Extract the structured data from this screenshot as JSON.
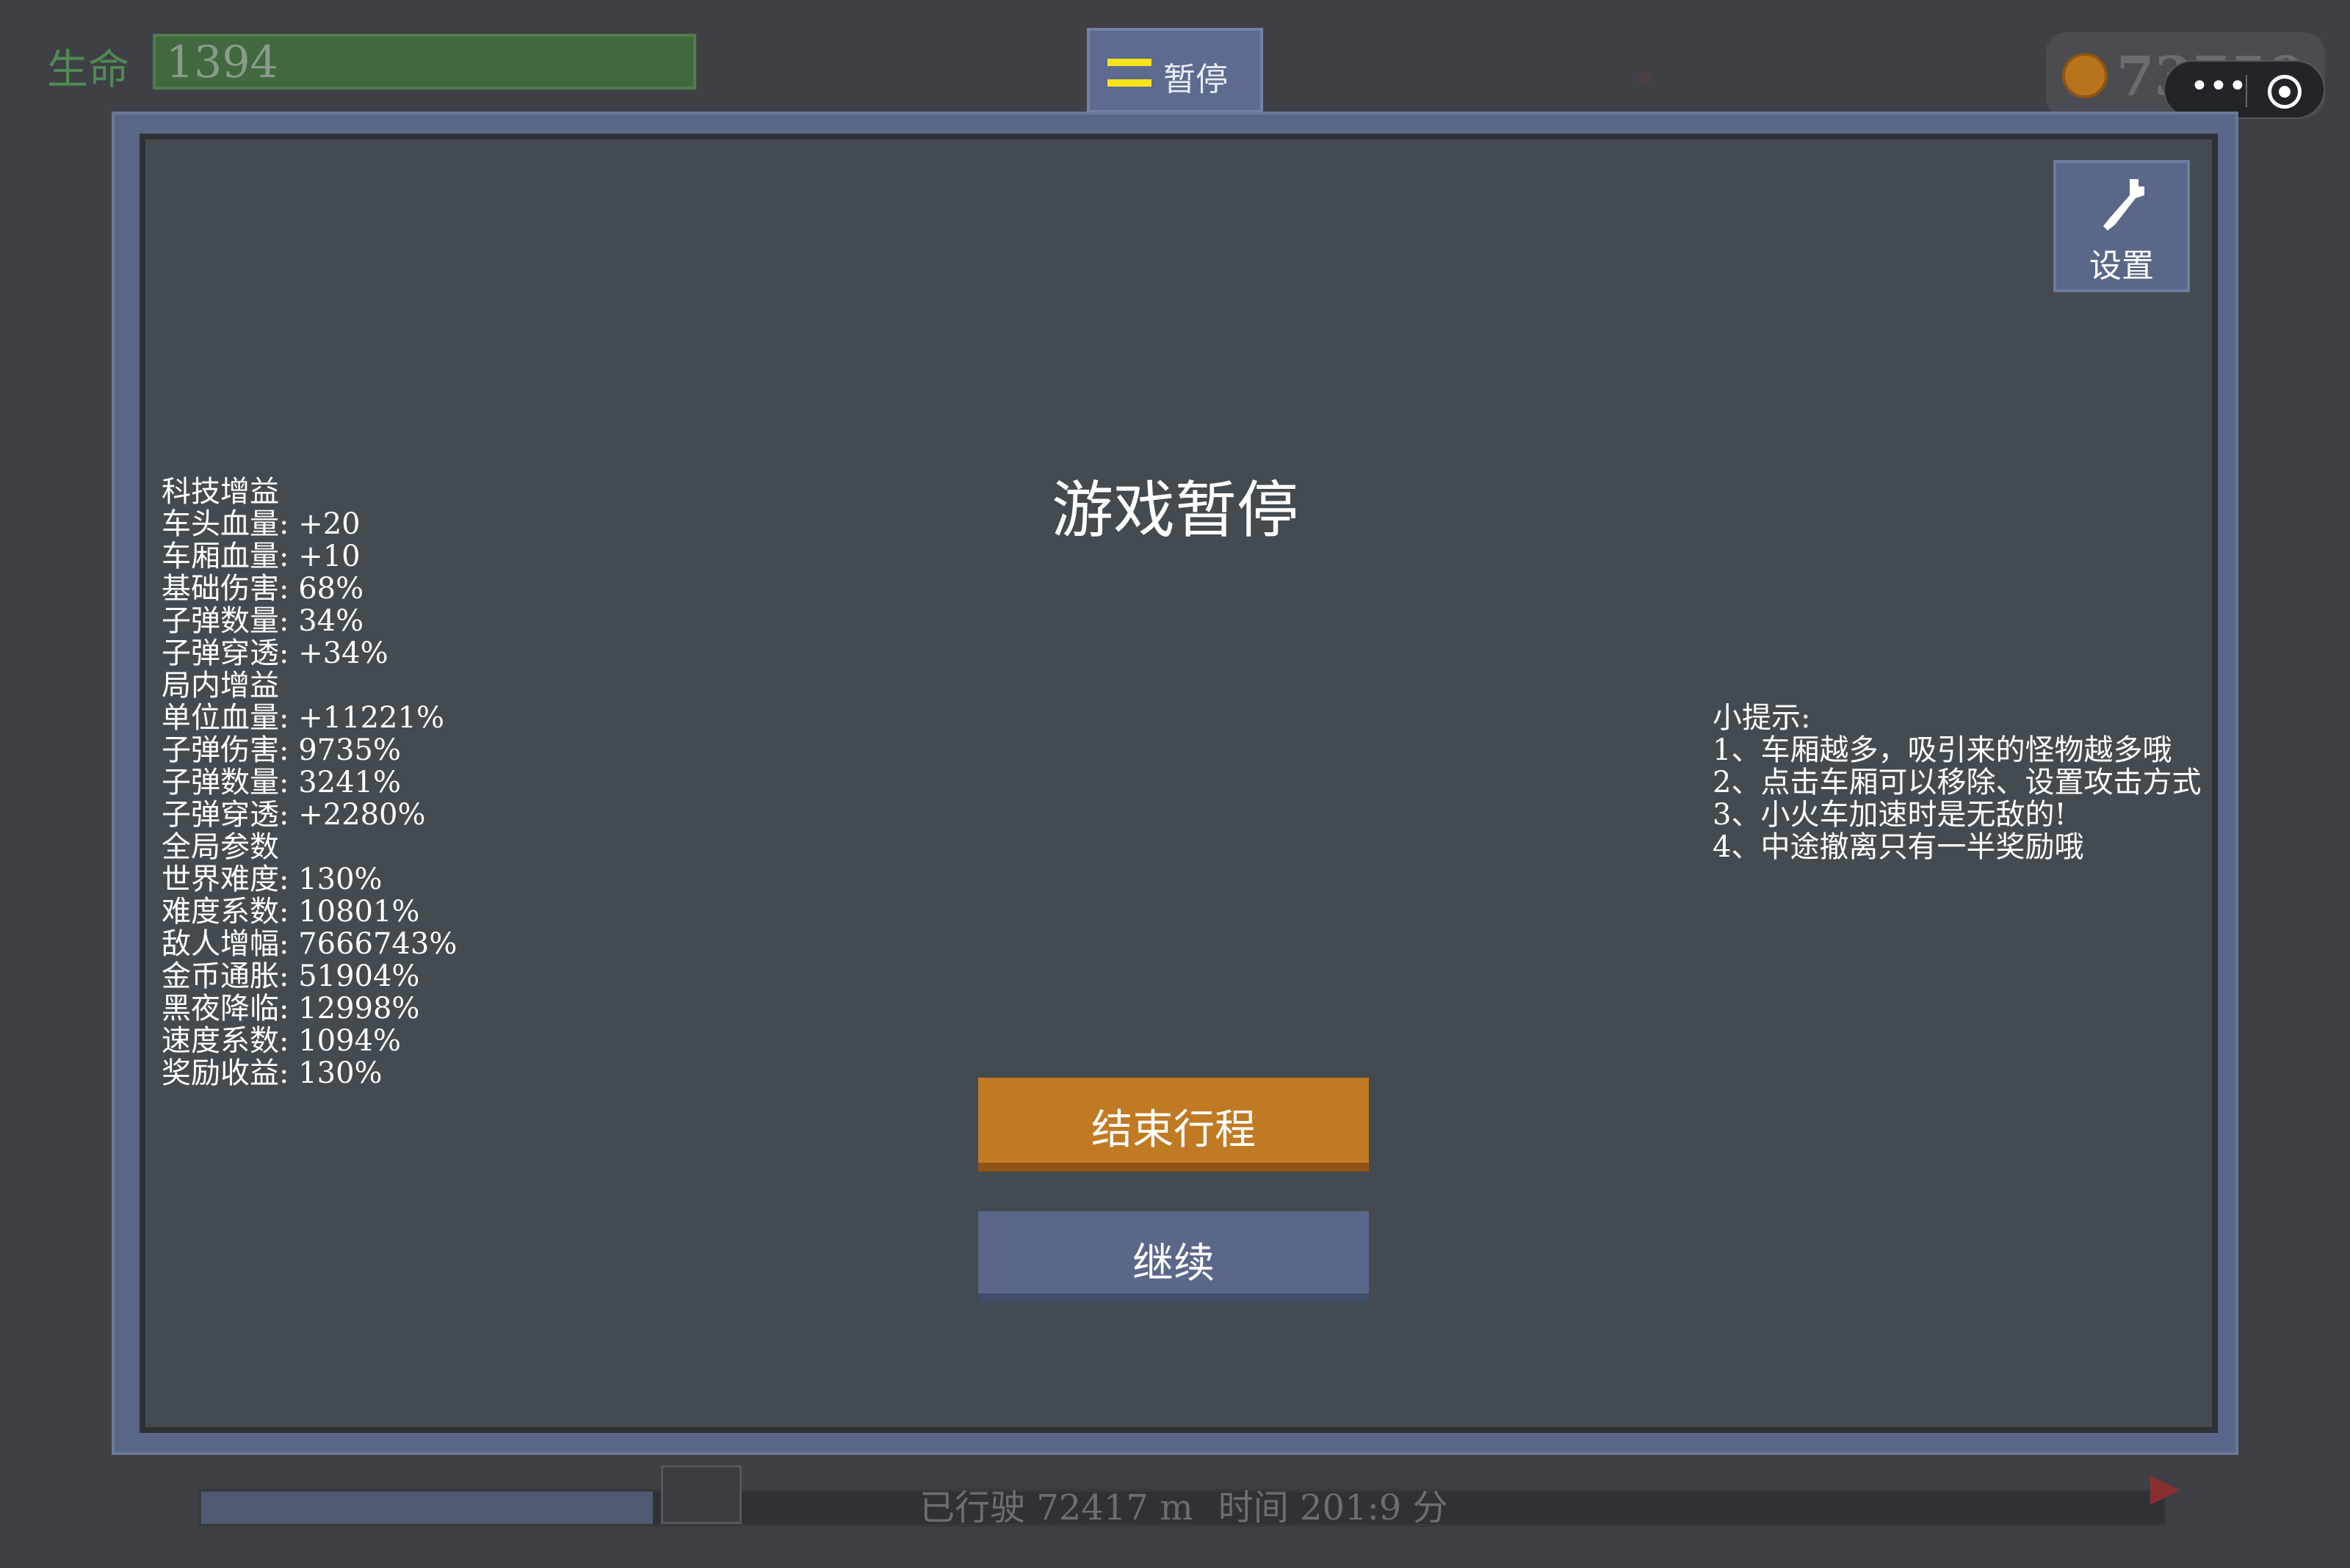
{
  "hud": {
    "hp_label": "生命",
    "hp_value": "1394",
    "pause_label": "暂停",
    "coins": "73759",
    "menu_dots": "•••"
  },
  "panel": {
    "title": "游戏暂停",
    "settings_label": "设置",
    "end_button": "结束行程",
    "continue_button": "继续"
  },
  "stats": [
    "科技增益",
    "车头血量: +20",
    "车厢血量: +10",
    "基础伤害: 68%",
    "子弹数量: 34%",
    "子弹穿透: +34%",
    "局内增益",
    "单位血量: +11221%",
    "子弹伤害: 9735%",
    "子弹数量: 3241%",
    "子弹穿透: +2280%",
    "全局参数",
    "世界难度: 130%",
    "难度系数: 10801%",
    "敌人增幅: 7666743%",
    "金币通胀: 51904%",
    "黑夜降临: 12998%",
    "速度系数: 1094%",
    "奖励收益: 130%"
  ],
  "tips": [
    "小提示:",
    "1、车厢越多，吸引来的怪物越多哦",
    "2、点击车厢可以移除、设置攻击方式",
    "3、小火车加速时是无敌的!",
    "4、中途撤离只有一半奖励哦"
  ],
  "footer": {
    "distance": "已行驶 72417 m",
    "time": "时间 201:9 分",
    "progress": 0.23
  },
  "colors": {
    "panel_bg": "#434b51",
    "panel_frame": "#5a6788",
    "end_button": "#c07a23",
    "continue_button": "#5a6788",
    "pause_icon": "#f5e31b"
  }
}
